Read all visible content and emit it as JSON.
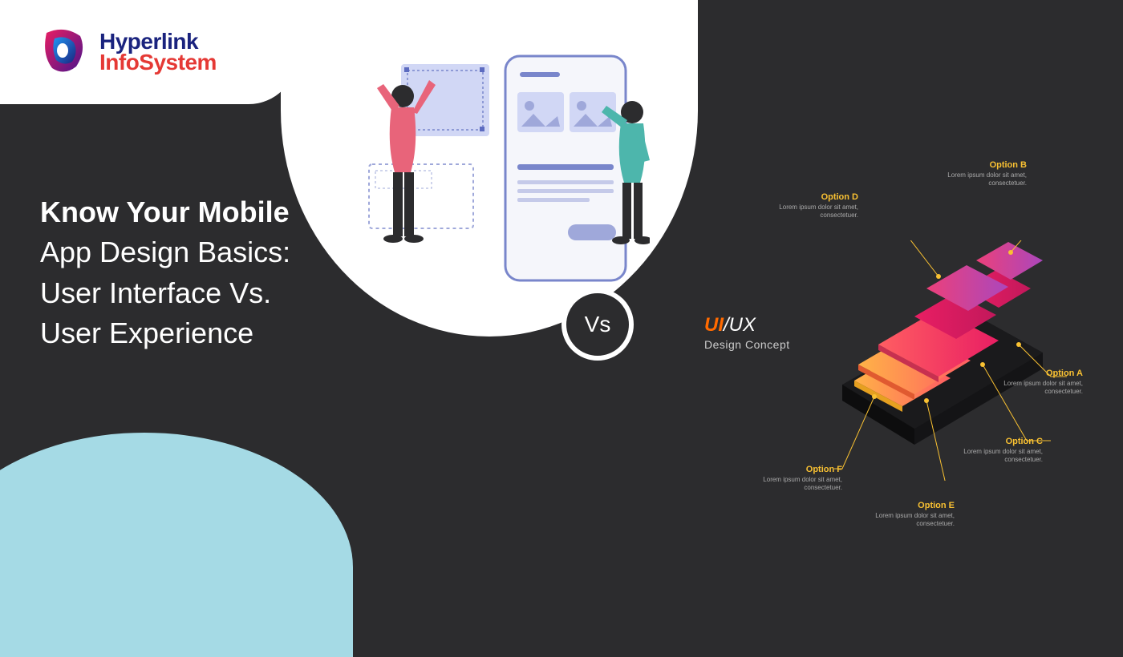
{
  "logo": {
    "line1": "Hyperlink",
    "line2": "InfoSystem"
  },
  "headline": {
    "bold": "Know Your Mobile",
    "l2": "App Design Basics:",
    "l3": "User Interface Vs.",
    "l4": "User Experience"
  },
  "vs": "Vs",
  "uiux": {
    "ui": "UI",
    "sep": "/",
    "ux": "UX",
    "sub": "Design Concept"
  },
  "options": {
    "a": {
      "title": "Option A",
      "desc": "Lorem ipsum dolor sit amet, consectetuer."
    },
    "b": {
      "title": "Option B",
      "desc": "Lorem ipsum dolor sit amet, consectetuer."
    },
    "c": {
      "title": "Option C",
      "desc": "Lorem ipsum dolor sit amet, consectetuer."
    },
    "d": {
      "title": "Option D",
      "desc": "Lorem ipsum dolor sit amet, consectetuer."
    },
    "e": {
      "title": "Option E",
      "desc": "Lorem ipsum dolor sit amet, consectetuer."
    },
    "f": {
      "title": "Option F",
      "desc": "Lorem ipsum dolor sit amet, consectetuer."
    }
  }
}
